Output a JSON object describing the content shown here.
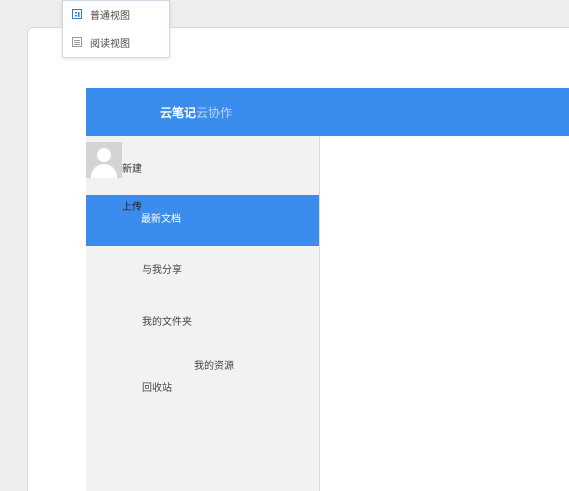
{
  "view_menu": {
    "items": [
      {
        "label": "普通视图",
        "icon": "grid-view-icon"
      },
      {
        "label": "阅读视图",
        "icon": "reading-view-icon"
      }
    ]
  },
  "header": {
    "brand_main": "云笔记",
    "brand_sub": "云协作"
  },
  "sidebar": {
    "new_label": "新建",
    "upload_label": "上传",
    "active_item": "最新文档",
    "items": [
      {
        "label": "与我分享"
      },
      {
        "label": "我的文件夹"
      },
      {
        "label": "我的资源"
      },
      {
        "label": "回收站"
      }
    ]
  },
  "colors": {
    "accent": "#3a8ded",
    "header_sub_text": "#bcd7fb",
    "sidebar_bg": "#f2f2f2"
  }
}
